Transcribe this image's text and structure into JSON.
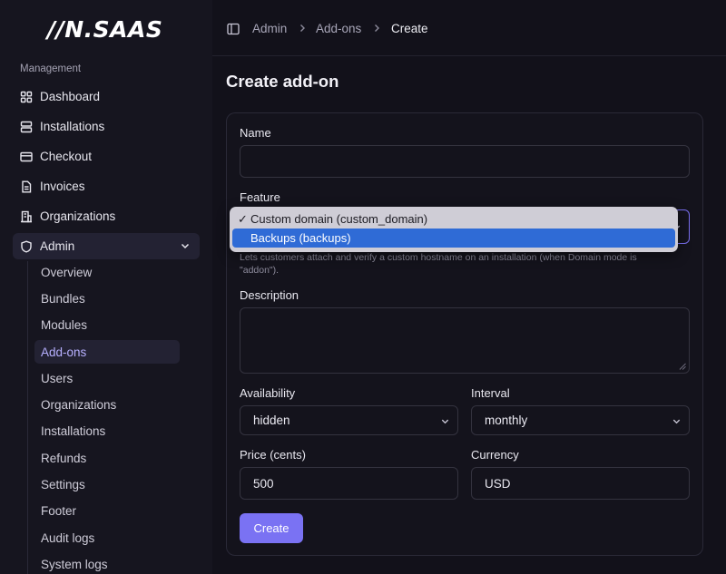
{
  "app": {
    "logo": "//N.SAAS"
  },
  "sidebar": {
    "section": "Management",
    "items": [
      {
        "label": "Dashboard",
        "icon": "grid-icon"
      },
      {
        "label": "Installations",
        "icon": "server-icon"
      },
      {
        "label": "Checkout",
        "icon": "credit-card-icon"
      },
      {
        "label": "Invoices",
        "icon": "document-icon"
      },
      {
        "label": "Organizations",
        "icon": "building-icon"
      },
      {
        "label": "Admin",
        "icon": "shield-icon"
      }
    ],
    "admin_sub": [
      "Overview",
      "Bundles",
      "Modules",
      "Add-ons",
      "Users",
      "Organizations",
      "Installations",
      "Refunds",
      "Settings",
      "Footer",
      "Audit logs",
      "System logs"
    ],
    "active_sub": "Add-ons"
  },
  "breadcrumb": [
    "Admin",
    "Add-ons",
    "Create"
  ],
  "page": {
    "title": "Create add-on"
  },
  "form": {
    "name_label": "Name",
    "name_value": "",
    "feature_label": "Feature",
    "feature_options": [
      "Custom domain (custom_domain)",
      "Backups (backups)"
    ],
    "feature_check": "✓",
    "feature_hint_line1": "Lets customers attach and verify a custom hostname on an installation (when Domain mode is",
    "feature_hint_line2": "\"addon\").",
    "description_label": "Description",
    "availability_label": "Availability",
    "availability_value": "hidden",
    "interval_label": "Interval",
    "interval_value": "monthly",
    "price_label": "Price (cents)",
    "price_value": "500",
    "currency_label": "Currency",
    "currency_value": "USD",
    "create_label": "Create"
  },
  "colors": {
    "accent": "#7a72f3",
    "highlight": "#2f6bd6",
    "background": "#12111a"
  }
}
